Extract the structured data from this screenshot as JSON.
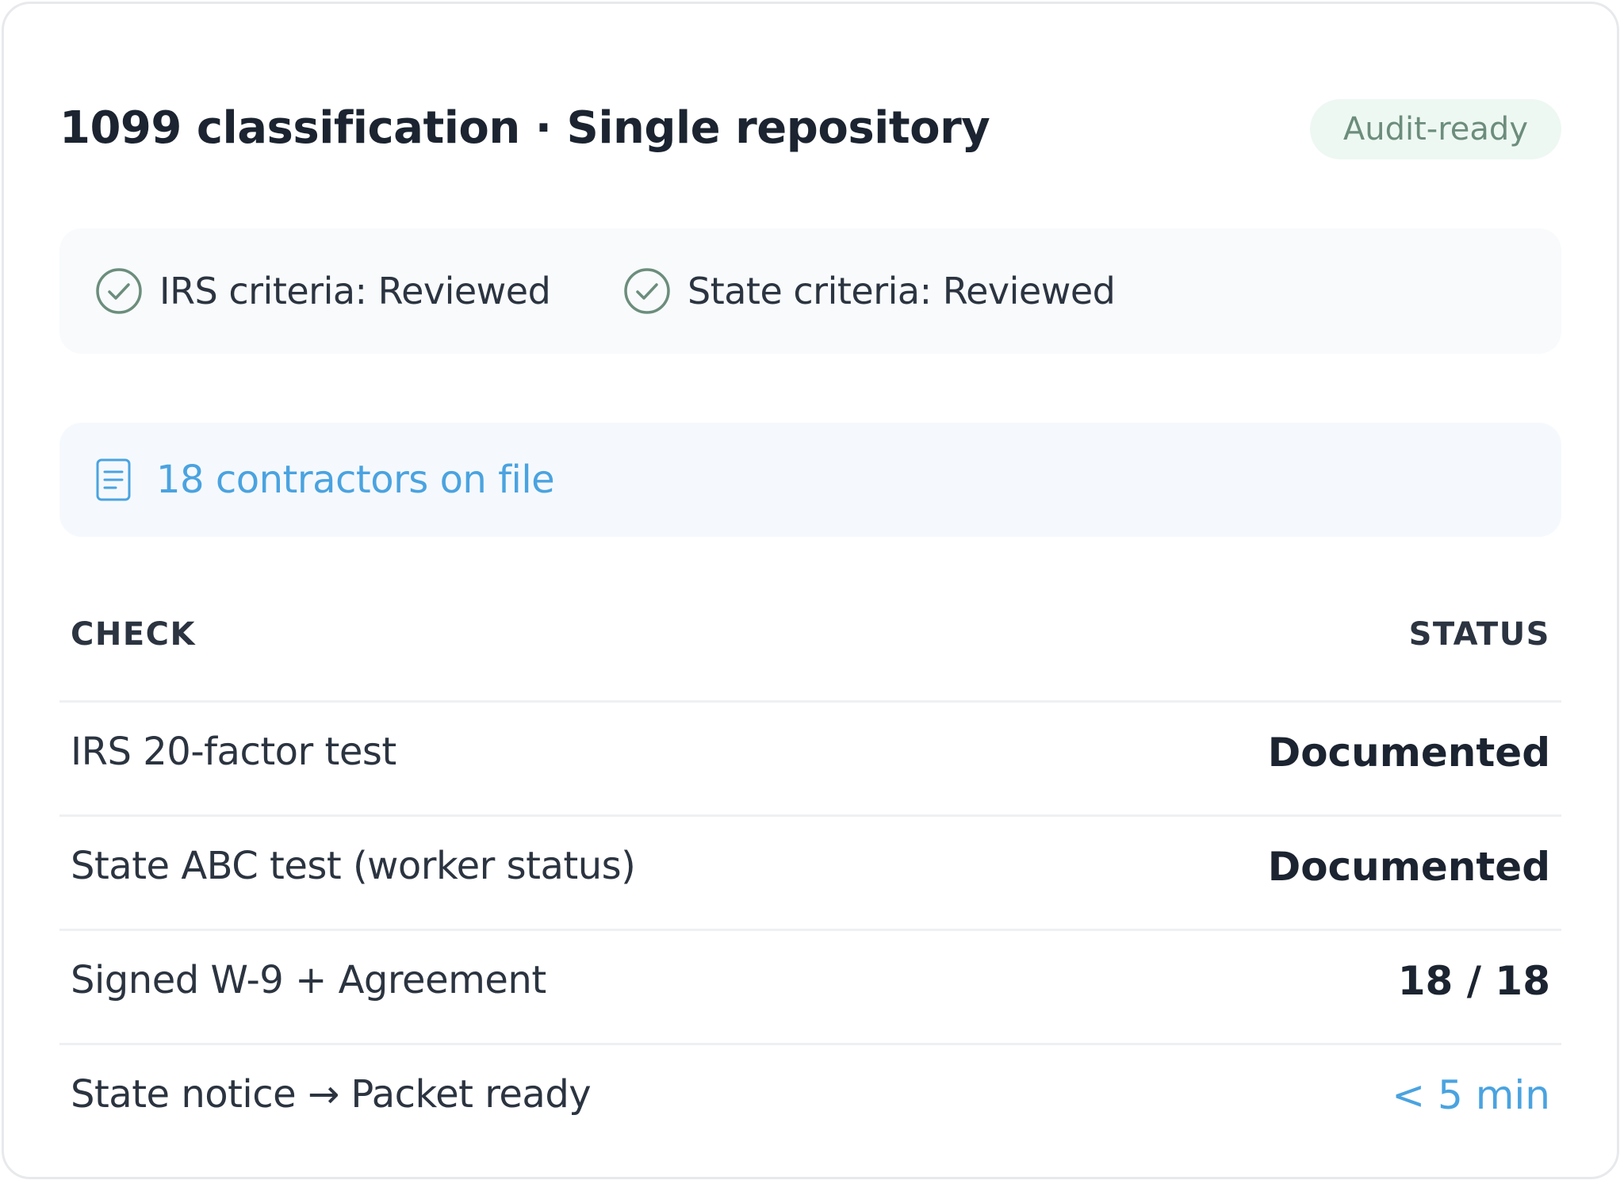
{
  "header": {
    "title": "1099 classification · Single repository",
    "badge": "Audit-ready"
  },
  "criteria": [
    {
      "label": "IRS criteria: Reviewed",
      "icon": "check-circle-icon"
    },
    {
      "label": "State criteria: Reviewed",
      "icon": "check-circle-icon"
    }
  ],
  "contractors": {
    "label": "18 contractors on file",
    "icon": "document-icon"
  },
  "table": {
    "headers": {
      "check": "CHECK",
      "status": "STATUS"
    },
    "rows": [
      {
        "check": "IRS 20-factor test",
        "status": "Documented"
      },
      {
        "check": "State ABC test (worker status)",
        "status": "Documented"
      },
      {
        "check": "Signed W-9 + Agreement",
        "status": "18 / 18"
      },
      {
        "check": "State notice → Packet ready",
        "status": "< 5 min"
      }
    ]
  },
  "colors": {
    "badge_bg": "#eef8f3",
    "badge_text": "#6c8d7c",
    "check_icon": "#6c8d7c",
    "accent": "#4aa3e0",
    "text_dark": "#1b2430"
  }
}
